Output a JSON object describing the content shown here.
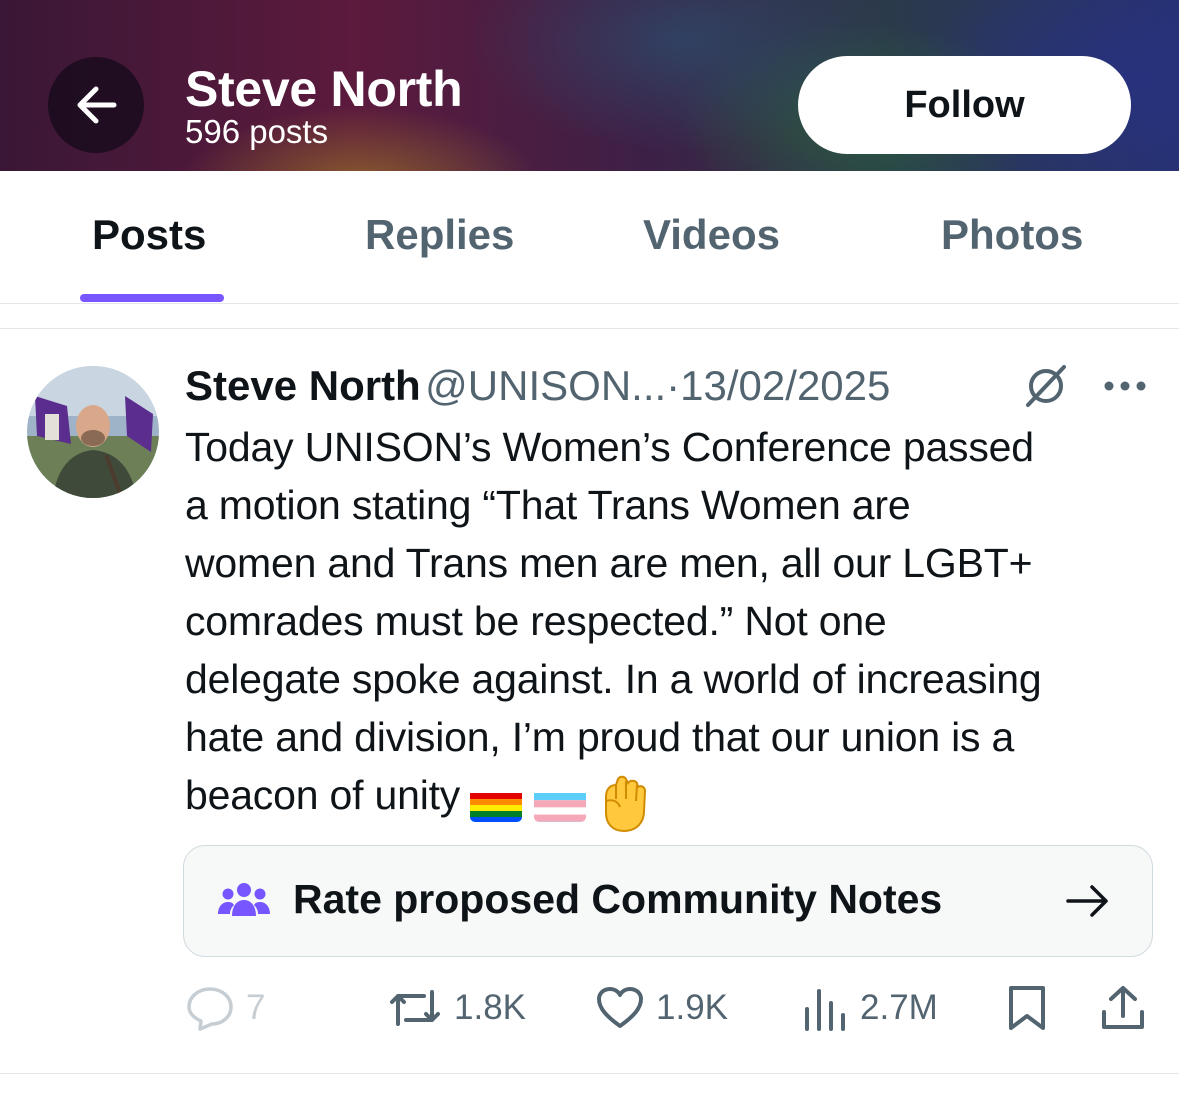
{
  "header": {
    "back_icon": "arrow-left-icon",
    "name": "Steve North",
    "post_count": "596 posts",
    "follow_label": "Follow"
  },
  "tabs": [
    {
      "label": "Posts",
      "active": true
    },
    {
      "label": "Replies",
      "active": false
    },
    {
      "label": "Videos",
      "active": false
    },
    {
      "label": "Photos",
      "active": false
    }
  ],
  "accent_color": "#7856ff",
  "post": {
    "author": "Steve North",
    "handle": "@UNISON...",
    "separator": "·",
    "date": "13/02/2025",
    "text_lines": [
      "Today UNISON’s Women’s Conference passed",
      "a motion stating “That Trans Women are",
      "women and Trans men are men, all our LGBT+",
      "comrades must be respected.” Not one",
      "delegate spoke against. In a world of increasing",
      "hate and division, I’m proud that our union is a",
      "beacon of unity"
    ],
    "emojis": [
      "rainbow-flag",
      "transgender-flag",
      "raised-fist"
    ],
    "community_notes_label": "Rate proposed Community Notes",
    "actions": {
      "replies": "7",
      "reposts": "1.8K",
      "likes": "1.9K",
      "views": "2.7M"
    }
  }
}
